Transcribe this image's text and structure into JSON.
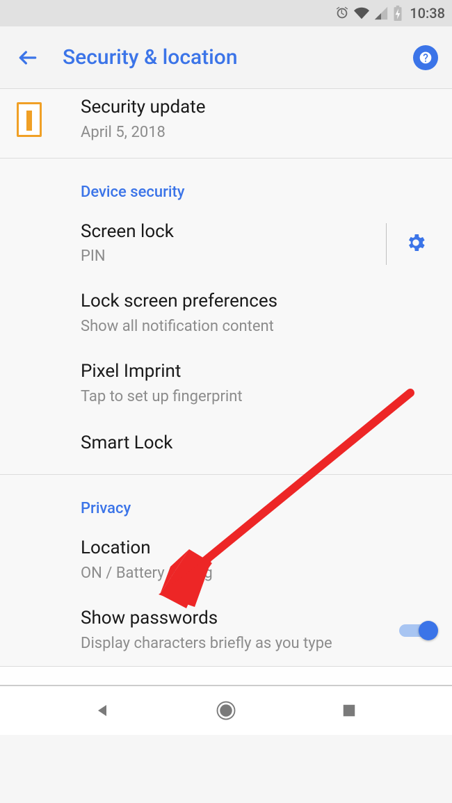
{
  "status": {
    "time": "10:38"
  },
  "header": {
    "title": "Security & location"
  },
  "security_update": {
    "title": "Security update",
    "date": "April 5, 2018"
  },
  "sections": {
    "device_security": {
      "label": "Device security",
      "items": {
        "screen_lock": {
          "title": "Screen lock",
          "subtitle": "PIN"
        },
        "lock_screen_prefs": {
          "title": "Lock screen preferences",
          "subtitle": "Show all notification content"
        },
        "pixel_imprint": {
          "title": "Pixel Imprint",
          "subtitle": "Tap to set up fingerprint"
        },
        "smart_lock": {
          "title": "Smart Lock"
        }
      }
    },
    "privacy": {
      "label": "Privacy",
      "items": {
        "location": {
          "title": "Location",
          "subtitle": "ON / Battery saving"
        },
        "show_passwords": {
          "title": "Show passwords",
          "subtitle": "Display characters briefly as you type",
          "toggle": true
        }
      }
    }
  }
}
